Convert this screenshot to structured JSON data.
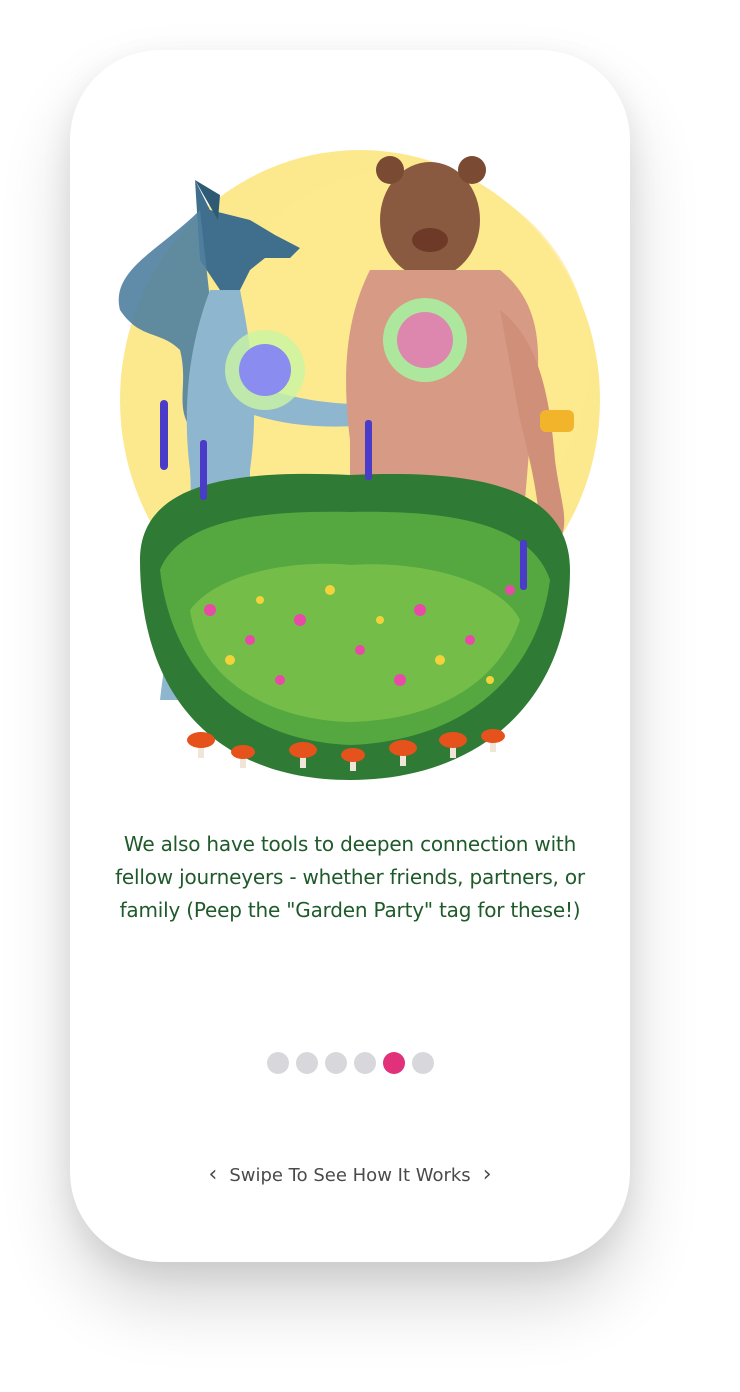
{
  "onboarding": {
    "caption": "We also have tools to deepen connection with fellow journeyers - whether friends, partners, or family (Peep the \"Garden Party\" tag for these!)",
    "pager": {
      "total": 6,
      "active_index": 4
    },
    "swipe_hint": "Swipe To See How It Works",
    "prev_icon": "chevron-left-icon",
    "next_icon": "chevron-right-icon"
  },
  "colors": {
    "caption_text": "#1f5a2a",
    "dot_inactive": "#d8d8dc",
    "dot_active": "#e0317a",
    "hint_text": "#4a4a4a"
  }
}
